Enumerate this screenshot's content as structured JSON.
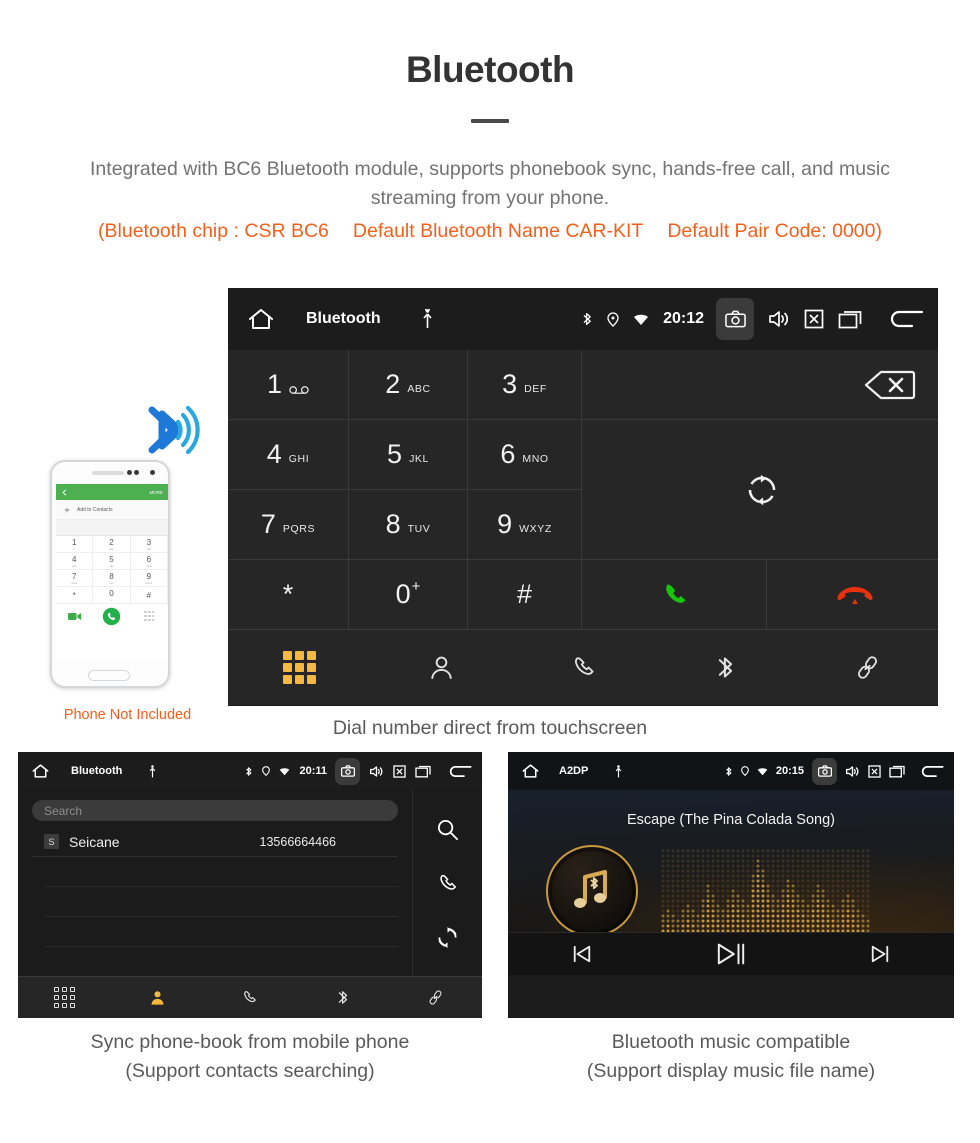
{
  "header": {
    "title": "Bluetooth",
    "description": "Integrated with BC6 Bluetooth module, supports phonebook sync, hands-free call, and music streaming from your phone.",
    "spec_chip": "(Bluetooth chip : CSR BC6",
    "spec_name": "Default Bluetooth Name CAR-KIT",
    "spec_pair": "Default Pair Code: 0000)",
    "accent_orange": "#f4601c",
    "body_gray": "#737373"
  },
  "phone_mock": {
    "caption": "Phone Not Included",
    "more_label": "MORE",
    "add_contacts_label": "Add to Contacts",
    "keys": [
      {
        "n": "1",
        "l": "∞"
      },
      {
        "n": "2",
        "l": "abc"
      },
      {
        "n": "3",
        "l": "def"
      },
      {
        "n": "4",
        "l": "ghi"
      },
      {
        "n": "5",
        "l": "jkl"
      },
      {
        "n": "6",
        "l": "mno"
      },
      {
        "n": "7",
        "l": "pqrs"
      },
      {
        "n": "8",
        "l": "tuv"
      },
      {
        "n": "9",
        "l": "wxyz"
      },
      {
        "n": "*",
        "l": ""
      },
      {
        "n": "0",
        "l": "+"
      },
      {
        "n": "#",
        "l": ""
      }
    ]
  },
  "main_unit": {
    "statusbar": {
      "title": "Bluetooth",
      "time": "20:12",
      "icons": [
        "home-icon",
        "usb-icon",
        "bluetooth-icon",
        "location-icon",
        "wifi-icon",
        "camera-icon",
        "volume-icon",
        "close-box-icon",
        "recents-icon",
        "back-icon"
      ]
    },
    "keys": [
      {
        "num": "1",
        "sub": "",
        "voicemail": true
      },
      {
        "num": "2",
        "sub": "ABC"
      },
      {
        "num": "3",
        "sub": "DEF"
      },
      {
        "num": "4",
        "sub": "GHI"
      },
      {
        "num": "5",
        "sub": "JKL"
      },
      {
        "num": "6",
        "sub": "MNO"
      },
      {
        "num": "7",
        "sub": "PQRS"
      },
      {
        "num": "8",
        "sub": "TUV"
      },
      {
        "num": "9",
        "sub": "WXYZ"
      },
      {
        "num": "*",
        "sub": ""
      },
      {
        "num": "0",
        "sup": "+"
      },
      {
        "num": "#",
        "sub": ""
      }
    ],
    "action_icons": {
      "backspace": "backspace-icon",
      "sync": "sync-icon",
      "call": "call-icon",
      "hangup": "hangup-icon"
    },
    "nav_items": [
      {
        "name": "dialpad",
        "active": true
      },
      {
        "name": "contacts",
        "active": false
      },
      {
        "name": "call-log",
        "active": false
      },
      {
        "name": "bluetooth",
        "active": false
      },
      {
        "name": "link",
        "active": false
      }
    ],
    "caption": "Dial number direct from touchscreen",
    "accent_active": "#f5b841",
    "call_green": "#16c50c",
    "hangup_red": "#e8310d"
  },
  "book_unit": {
    "statusbar": {
      "title": "Bluetooth",
      "time": "20:11"
    },
    "search_placeholder": "Search",
    "contacts": [
      {
        "initial": "S",
        "name": "Seicane",
        "number": "13566664466"
      }
    ],
    "side_icons": [
      "search-icon",
      "call-icon",
      "sync-icon"
    ],
    "nav_items": [
      {
        "name": "dialpad",
        "active": false
      },
      {
        "name": "contacts",
        "active": true
      },
      {
        "name": "call-log",
        "active": false
      },
      {
        "name": "bluetooth",
        "active": false
      },
      {
        "name": "link",
        "active": false
      }
    ],
    "caption_line1": "Sync phone-book from mobile phone",
    "caption_line2": "(Support contacts searching)"
  },
  "music_unit": {
    "statusbar": {
      "title": "A2DP",
      "time": "20:15"
    },
    "song_title": "Escape (The Pina Colada Song)",
    "controls": [
      "previous-icon",
      "play-pause-icon",
      "next-icon"
    ],
    "caption_line1": "Bluetooth music compatible",
    "caption_line2": "(Support display music file name)",
    "gold": "#d2a143"
  }
}
